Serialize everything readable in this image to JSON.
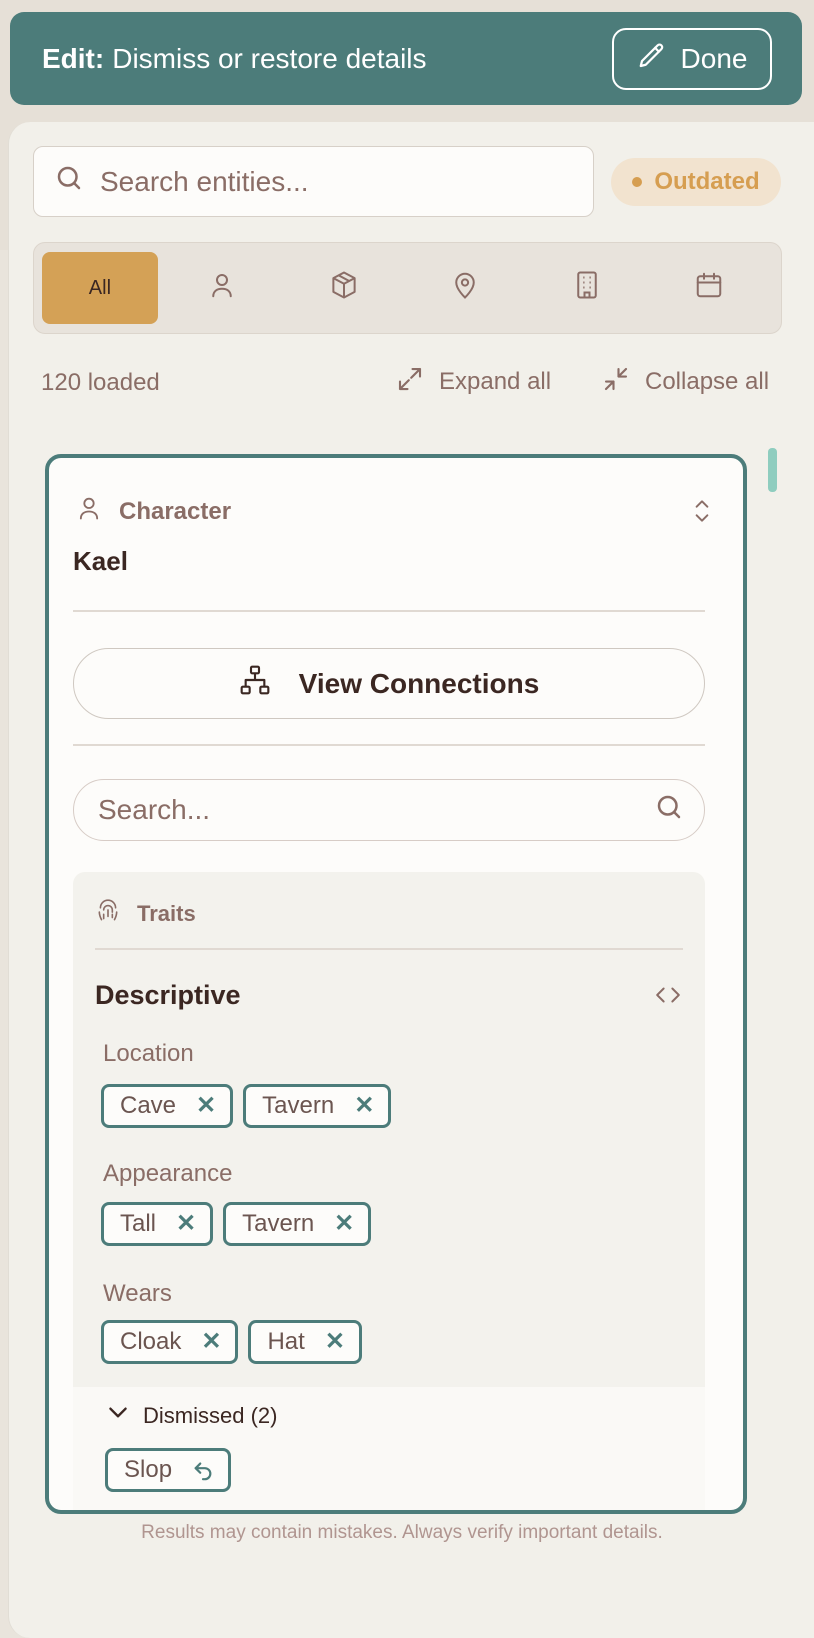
{
  "edit_bar": {
    "label_strong": "Edit:",
    "label_rest": "Dismiss or restore details",
    "done_label": "Done"
  },
  "search": {
    "placeholder": "Search entities..."
  },
  "status_badge": "Outdated",
  "filters": [
    {
      "label": "All",
      "icon": "all",
      "active": true
    },
    {
      "label": "",
      "icon": "person-icon"
    },
    {
      "label": "",
      "icon": "box-icon"
    },
    {
      "label": "",
      "icon": "map-pin-icon"
    },
    {
      "label": "",
      "icon": "building-icon"
    },
    {
      "label": "",
      "icon": "calendar-icon"
    }
  ],
  "toolbar": {
    "loaded": "120 loaded",
    "expand_all": "Expand all",
    "collapse_all": "Collapse all"
  },
  "card": {
    "type": "Character",
    "name": "Kael",
    "view_connections": "View Connections",
    "search_placeholder": "Search...",
    "traits_label": "Traits",
    "section_title": "Descriptive",
    "groups": [
      {
        "label": "Location",
        "chips": [
          "Cave",
          "Tavern"
        ]
      },
      {
        "label": "Appearance",
        "chips": [
          "Tall",
          "Tavern"
        ]
      },
      {
        "label": "Wears",
        "chips": [
          "Cloak",
          "Hat"
        ]
      }
    ],
    "dismissed_label": "Dismissed (2)",
    "dismissed_chips": [
      "Slop"
    ]
  },
  "footer": "Results may contain mistakes. Always verify important details.",
  "colors": {
    "teal": "#4c7c7a",
    "accent_gold": "#d4a156",
    "outdated": "#d69e51",
    "scroll_thumb": "#8fcdbf"
  }
}
